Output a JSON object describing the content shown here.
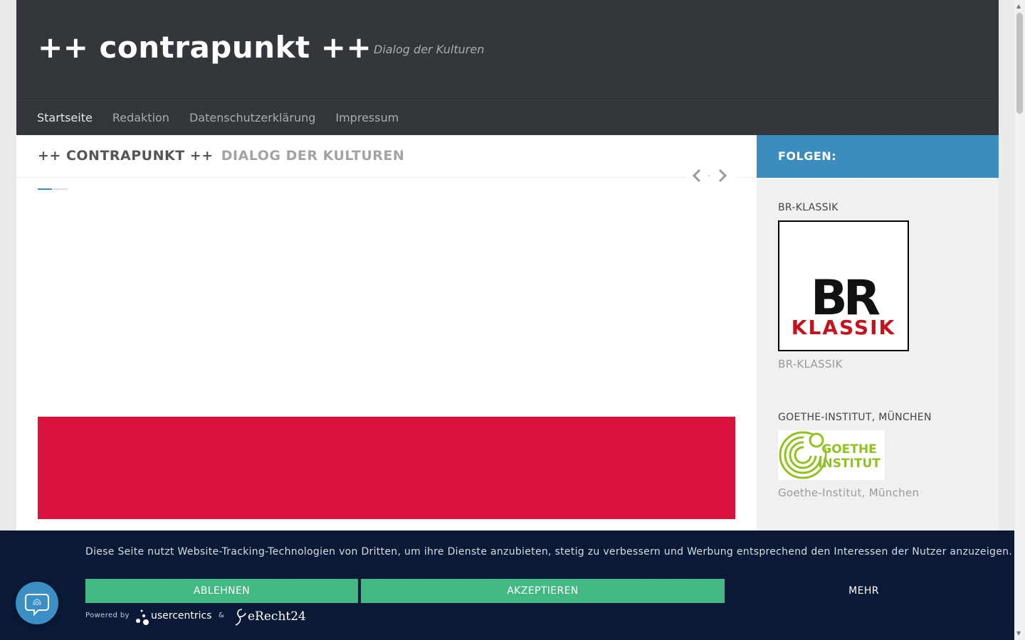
{
  "header": {
    "site_title": "++ contrapunkt ++",
    "tagline": "Dialog der Kulturen"
  },
  "nav": {
    "items": [
      {
        "label": "Startseite",
        "active": true
      },
      {
        "label": "Redaktion",
        "active": false
      },
      {
        "label": "Datenschutzerklärung",
        "active": false
      },
      {
        "label": "Impressum",
        "active": false
      }
    ]
  },
  "main": {
    "heading_part1": "++ CONTRAPUNKT ++",
    "heading_part2": "DIALOG DER KULTUREN",
    "slider_prev_icon": "chevron-left-icon",
    "slider_next_icon": "chevron-right-icon",
    "banner_color": "#da143d"
  },
  "sidebar": {
    "follow_title": "FOLGEN:",
    "widgets": [
      {
        "title": "BR-KLASSIK",
        "logo_line1": "BR",
        "logo_line2": "KLASSIK",
        "caption": "BR-KLASSIK"
      },
      {
        "title": "GOETHE-INSTITUT, MÜNCHEN",
        "logo_line1": "GOETHE",
        "logo_line2": "INSTITUT",
        "caption": "Goethe-Institut, München"
      }
    ]
  },
  "cookie_banner": {
    "text": "Diese Seite nutzt Website-Tracking-Technologien von Dritten, um ihre Dienste anzubieten, stetig zu verbessern und Werbung entsprechend den Interessen der Nutzer anzuzeigen.",
    "decline_label": "ABLEHNEN",
    "accept_label": "AKZEPTIEREN",
    "more_label": "MEHR",
    "powered_by": "Powered by",
    "usercentrics_label": "usercentrics",
    "ampersand": "&",
    "erecht_label": "eRecht24"
  },
  "colors": {
    "header_bg": "#33363b",
    "accent_blue": "#3b8dbd",
    "button_green": "#44b882",
    "cookie_bg": "#0a1a36"
  }
}
